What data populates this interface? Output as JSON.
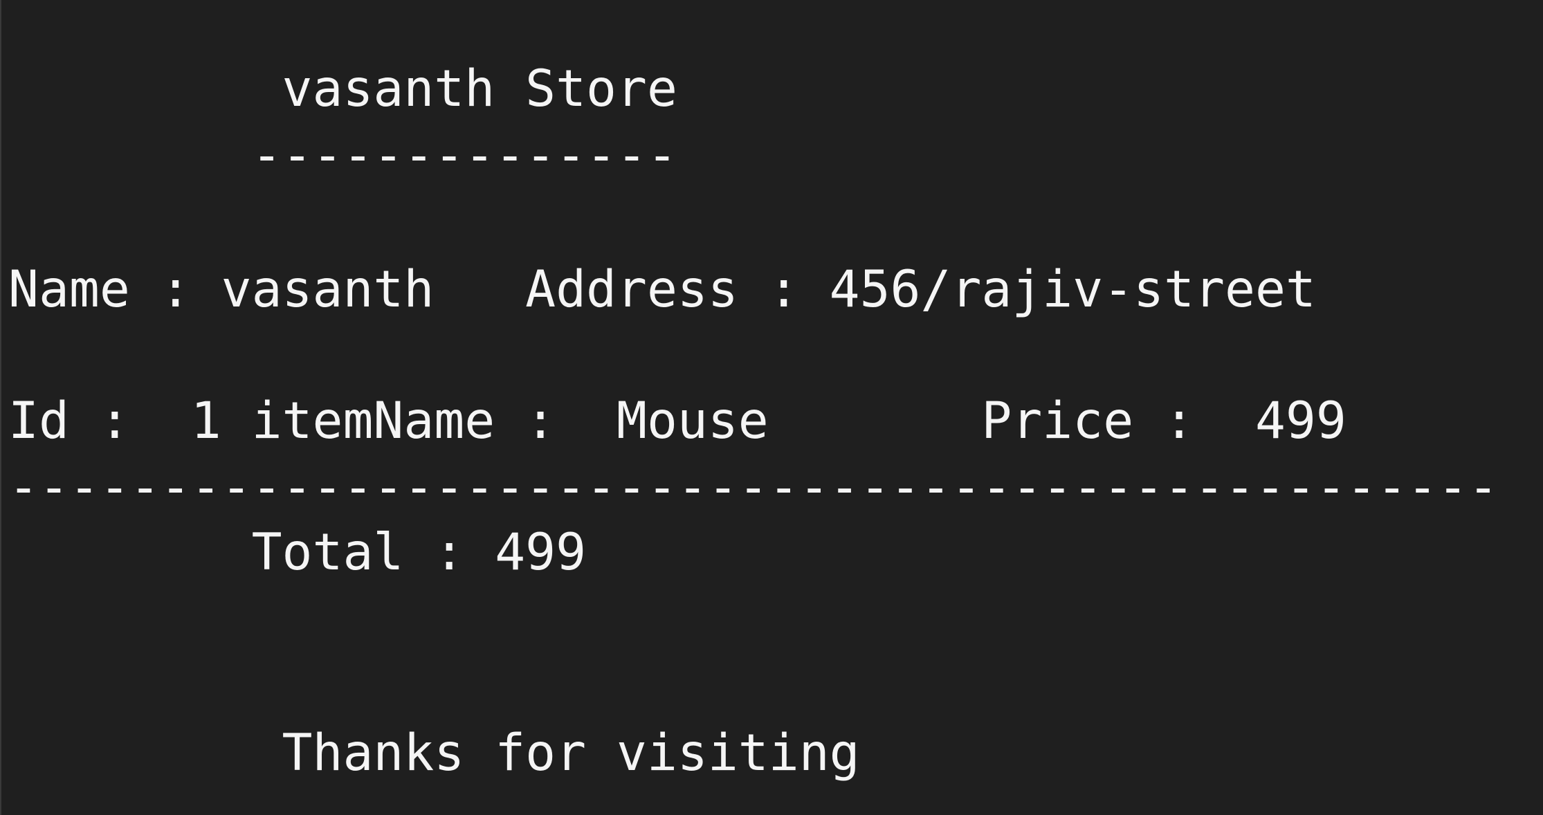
{
  "receipt": {
    "title_line": "         vasanth Store",
    "title_rule": "        --------------",
    "customer_line": "Name : vasanth   Address : 456/rajiv-street",
    "item_line": "Id :  1 itemName :  Mouse       Price :  499",
    "separator": "-------------------------------------------------",
    "total_line": "        Total : 499",
    "thanks_line": "         Thanks for visiting"
  }
}
